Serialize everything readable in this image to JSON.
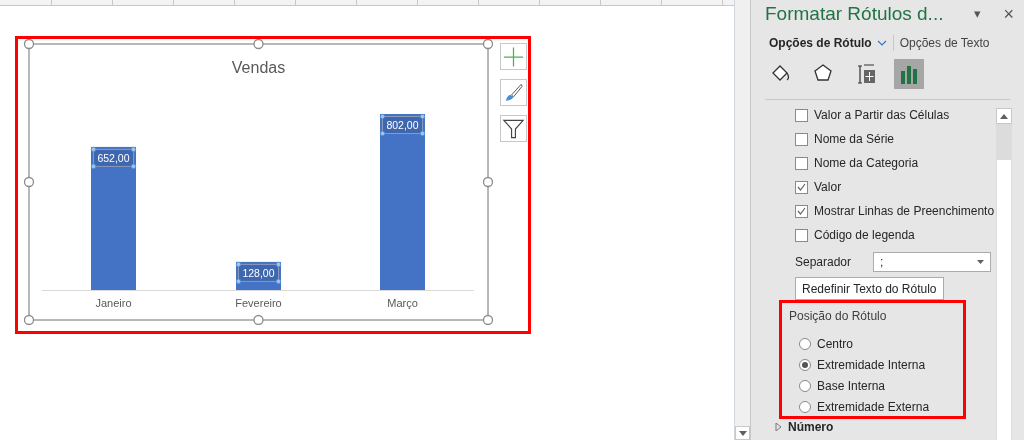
{
  "chart": {
    "chart_data": {
      "type": "bar",
      "title": "Vendas",
      "categories": [
        "Janeiro",
        "Fevereiro",
        "Março"
      ],
      "values": [
        652,
        128,
        802
      ],
      "value_labels": [
        "652,00",
        "128,00",
        "802,00"
      ]
    }
  },
  "chart_buttons": [
    {
      "kind": "add"
    },
    {
      "kind": "style"
    },
    {
      "kind": "filter"
    }
  ],
  "pane": {
    "title": "Formatar Rótulos d...",
    "menu": "▾",
    "close": "×",
    "tabs": [
      {
        "label": "Opções de Rótulo",
        "selected": true
      },
      {
        "label": "Opções de Texto",
        "selected": false
      }
    ],
    "icon_tabs": [
      {
        "kind": "fill",
        "selected": false
      },
      {
        "kind": "effects",
        "selected": false
      },
      {
        "kind": "size",
        "selected": false
      },
      {
        "kind": "options",
        "selected": true
      }
    ],
    "checkboxes": [
      {
        "label": "Valor a Partir das Células",
        "checked": false
      },
      {
        "label": "Nome da Série",
        "checked": false
      },
      {
        "label": "Nome da Categoria",
        "checked": false
      },
      {
        "label": "Valor",
        "checked": true
      },
      {
        "label": "Mostrar Linhas de Preenchimento",
        "checked": true
      },
      {
        "label": "Código de legenda",
        "checked": false
      }
    ],
    "separator": {
      "label": "Separador",
      "value": ";"
    },
    "reset_button": "Redefinir Texto do Rótulo",
    "position": {
      "title": "Posição do Rótulo",
      "options": [
        {
          "label": "Centro",
          "selected": false
        },
        {
          "label": "Extremidade Interna",
          "selected": true
        },
        {
          "label": "Base Interna",
          "selected": false
        },
        {
          "label": "Extremidade Externa",
          "selected": false
        }
      ]
    },
    "next_section": {
      "label": "Número",
      "expanded": false
    }
  }
}
